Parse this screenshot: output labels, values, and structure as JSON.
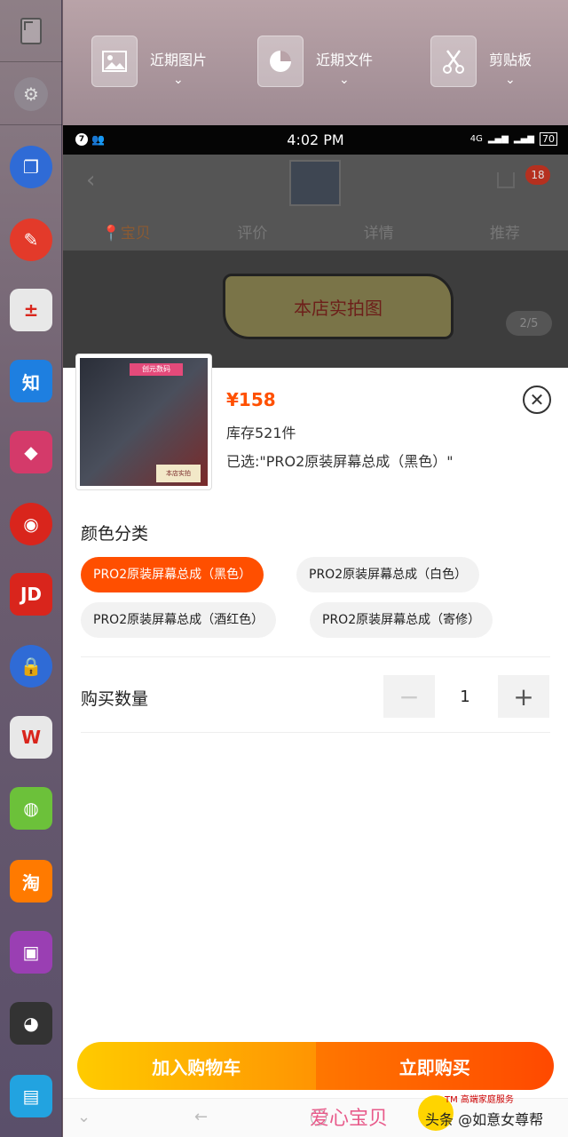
{
  "sidebar": {
    "apps": [
      {
        "name": "copy-app-icon",
        "glyph": "❐",
        "bg": "#2f6bd6"
      },
      {
        "name": "pin-app-icon",
        "glyph": "✎",
        "bg": "#e33a2a"
      },
      {
        "name": "calculator-app-icon",
        "glyph": "±",
        "bg": "#e8e8e8"
      },
      {
        "name": "zhihu-app-icon",
        "glyph": "知",
        "bg": "#1e7fe0"
      },
      {
        "name": "game-cube-app-icon",
        "glyph": "◆",
        "bg": "#d43a6a"
      },
      {
        "name": "music-app-icon",
        "glyph": "◉",
        "bg": "#d9251c"
      },
      {
        "name": "jd-app-icon",
        "glyph": "JD",
        "bg": "#d9251c"
      },
      {
        "name": "lock-app-icon",
        "glyph": "🔒",
        "bg": "#2f6bd6"
      },
      {
        "name": "wps-app-icon",
        "glyph": "W",
        "bg": "#e8e8e8"
      },
      {
        "name": "wechat-app-icon",
        "glyph": "◍",
        "bg": "#6cc13a"
      },
      {
        "name": "taobao-app-icon",
        "glyph": "淘",
        "bg": "#ff7a00"
      },
      {
        "name": "gameboy-app-icon",
        "glyph": "▣",
        "bg": "#9a3fb3"
      },
      {
        "name": "qq-app-icon",
        "glyph": "◕",
        "bg": "#333333"
      },
      {
        "name": "file-app-icon",
        "glyph": "▤",
        "bg": "#22a3e0"
      }
    ]
  },
  "topbar": {
    "shortcuts": [
      {
        "label": "近期图片",
        "icon": "image-icon"
      },
      {
        "label": "近期文件",
        "icon": "pie-chart-icon"
      },
      {
        "label": "剪贴板",
        "icon": "scissors-icon"
      }
    ]
  },
  "status_bar": {
    "notif_count": "7",
    "time": "4:02 PM",
    "network": "4G",
    "battery": "70"
  },
  "background_page": {
    "cart_count": "18",
    "tabs": [
      "宝贝",
      "评价",
      "详情",
      "推荐"
    ],
    "banner_text": "本店实拍图",
    "page_indicator": "2/5"
  },
  "product": {
    "image_tag": "创元数码",
    "image_label": "本店实拍",
    "price": "¥158",
    "stock": "库存521件",
    "selected": "已选:\"PRO2原装屏幕总成（黑色）\""
  },
  "color_section": {
    "title": "颜色分类",
    "options": [
      "PRO2原装屏幕总成（黑色）",
      "PRO2原装屏幕总成（白色）",
      "PRO2原装屏幕总成（酒红色）",
      "PRO2原装屏幕总成（寄修）"
    ],
    "selected_index": 0
  },
  "quantity": {
    "title": "购买数量",
    "minus": "−",
    "plus": "+",
    "value": "1"
  },
  "actions": {
    "add_to_cart": "加入购物车",
    "buy_now": "立即购买"
  },
  "watermark": {
    "left": "爱心宝贝",
    "badge_small": "TM 高端家庭服务",
    "badge_main": "头条 @如意女尊帮"
  }
}
